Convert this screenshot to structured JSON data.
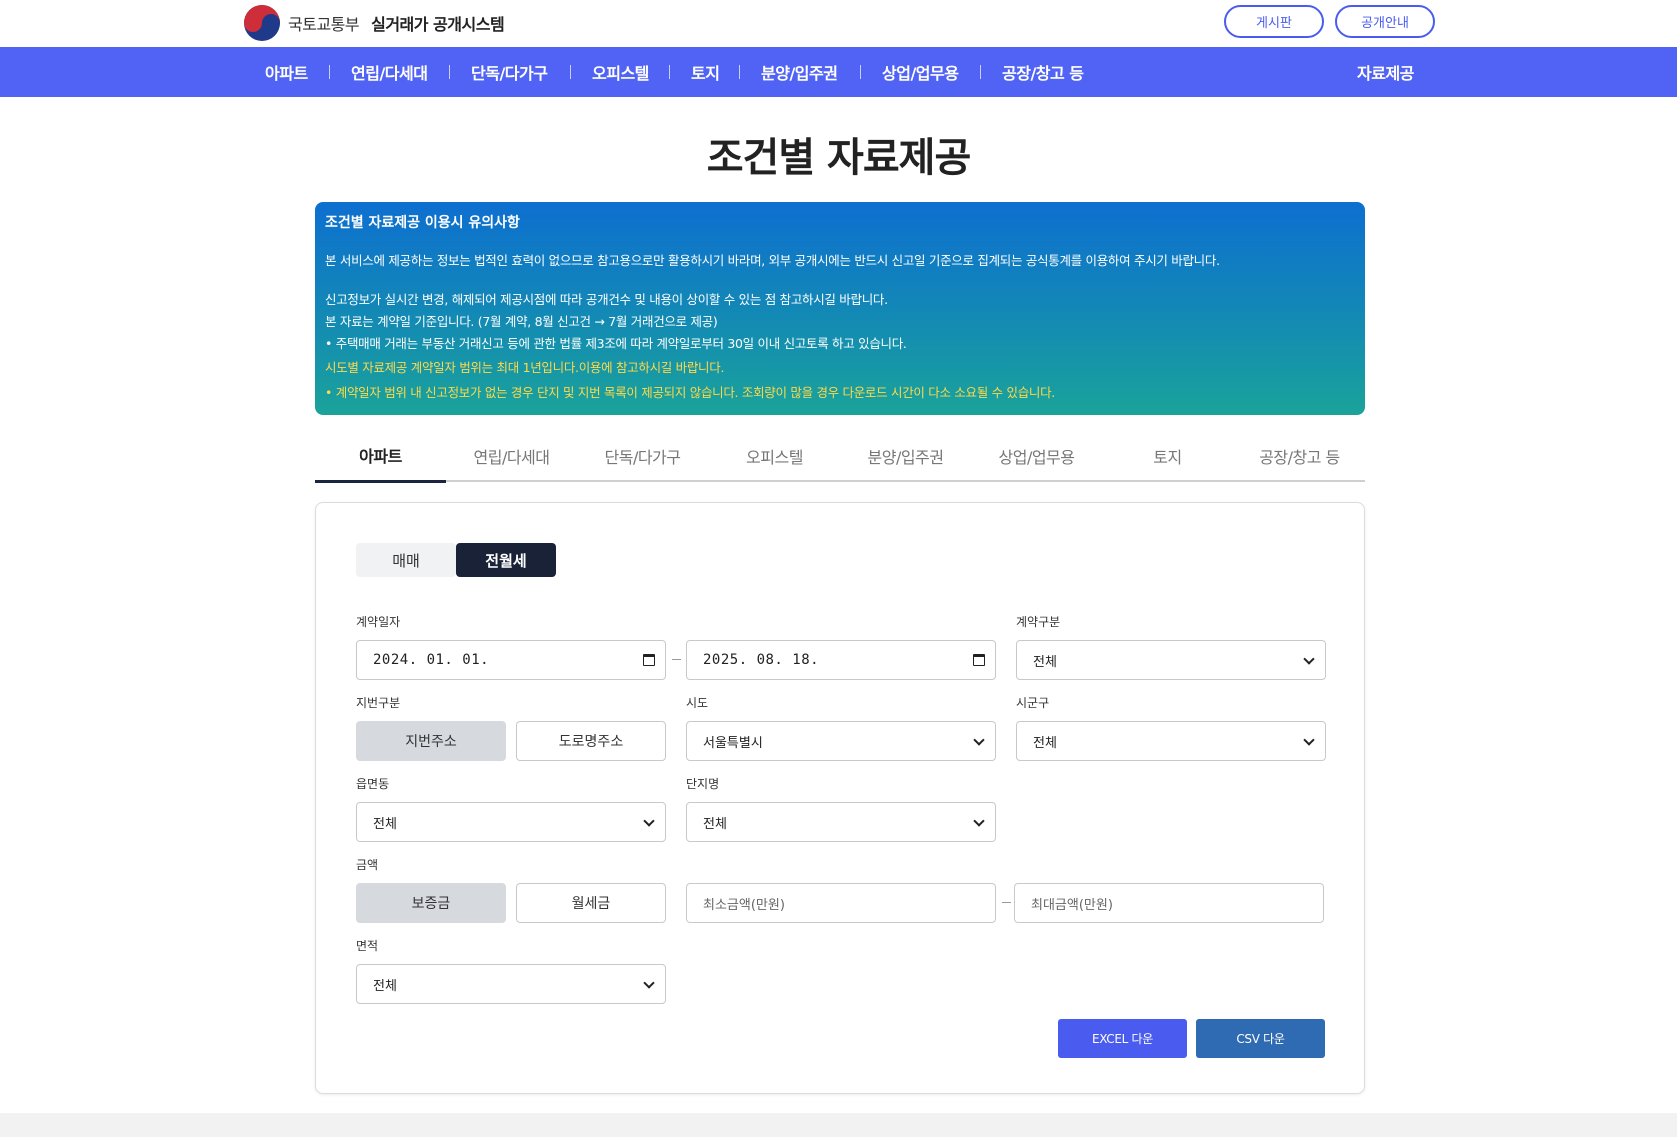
{
  "header": {
    "ministry": "국토교통부",
    "system_name": "실거래가 공개시스템",
    "board_label": "게시판",
    "guide_label": "공개안내"
  },
  "nav": {
    "items": [
      "아파트",
      "연립/다세대",
      "단독/다가구",
      "오피스텔",
      "토지",
      "분양/입주권",
      "상업/업무용",
      "공장/창고 등"
    ],
    "right": "자료제공"
  },
  "page_title": "조건별 자료제공",
  "notice": {
    "title": "조건별 자료제공 이용시 유의사항",
    "line1": "본 서비스에 제공하는 정보는 법적인 효력이 없으므로 참고용으로만 활용하시기 바라며, 외부 공개시에는 반드시 신고일 기준으로 집계되는 공식통계를 이용하여 주시기 바랍니다.",
    "line2": "신고정보가 실시간 변경, 해제되어 제공시점에 따라 공개건수 및 내용이 상이할 수 있는 점 참고하시길 바랍니다.",
    "line3": "본 자료는 계약일 기준입니다. (7월 계약, 8월 신고건 → 7월 거래건으로 제공)",
    "line4": "• 주택매매 거래는 부동산 거래신고 등에 관한 법률 제3조에 따라 계약일로부터 30일 이내 신고토록 하고 있습니다.",
    "line5": "시도별 자료제공 계약일자 범위는 최대 1년입니다.이용에 참고하시길 바랍니다.",
    "line6": "• 계약일자 범위 내 신고정보가 없는 경우 단지 및 지번 목록이 제공되지 않습니다. 조회량이 많을 경우 다운로드 시간이 다소 소요될 수 있습니다."
  },
  "tabs": [
    "아파트",
    "연립/다세대",
    "단독/다가구",
    "오피스텔",
    "분양/입주권",
    "상업/업무용",
    "토지",
    "공장/창고 등"
  ],
  "deal_type": {
    "sale": "매매",
    "rent": "전월세"
  },
  "form": {
    "contract_date_label": "계약일자",
    "date_from": "2024. 01. 01.",
    "date_to": "2025. 08. 18.",
    "contract_type_label": "계약구분",
    "contract_type_value": "전체",
    "lot_type_label": "지번구분",
    "lot_address": "지번주소",
    "road_address": "도로명주소",
    "sido_label": "시도",
    "sido_value": "서울특별시",
    "sigungu_label": "시군구",
    "sigungu_value": "전체",
    "dong_label": "읍면동",
    "dong_value": "전체",
    "complex_label": "단지명",
    "complex_value": "전체",
    "amount_label": "금액",
    "deposit": "보증금",
    "monthly": "월세금",
    "min_placeholder": "최소금액(만원)",
    "max_placeholder": "최대금액(만원)",
    "area_label": "면적",
    "area_value": "전체",
    "excel_label": "EXCEL 다운",
    "csv_label": "CSV 다운"
  },
  "colors": {
    "brand": "#5063f5",
    "dark_tab": "#1a2238",
    "excel": "#4a5cf0",
    "csv": "#2f6bb3"
  }
}
